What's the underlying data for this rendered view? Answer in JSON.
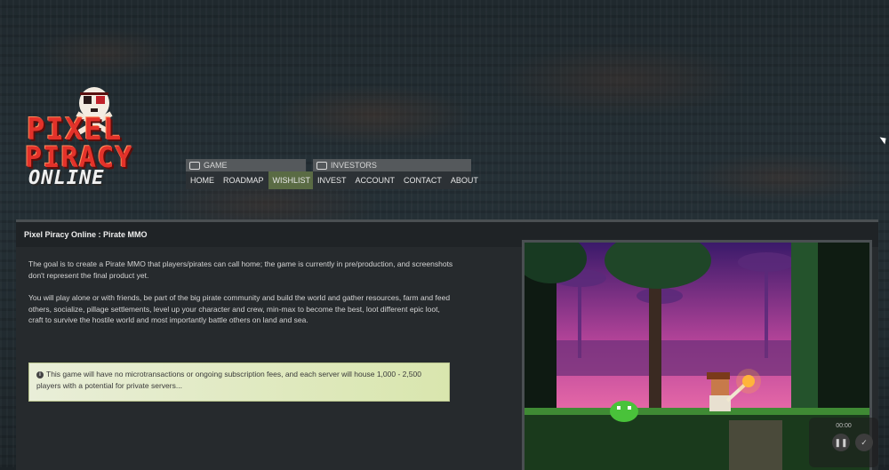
{
  "logo": {
    "line1": "PIXEL",
    "line2": "PIRACY",
    "line3": "ONLINE"
  },
  "nav": {
    "game": {
      "header": "GAME",
      "icon": "gamepad-icon",
      "items": [
        "HOME",
        "ROADMAP",
        "WISHLIST"
      ],
      "active": "WISHLIST"
    },
    "investors": {
      "header": "INVESTORS",
      "icon": "cash-icon",
      "items": [
        "INVEST",
        "ACCOUNT",
        "CONTACT",
        "ABOUT"
      ]
    }
  },
  "panel": {
    "title": "Pixel Piracy Online : Pirate MMO",
    "para1": "The goal is to create a Pirate MMO that players/pirates can call home; the game is currently in pre/production, and screenshots don't represent the final product yet.",
    "para2": "You will play alone or with friends, be part of the big pirate community and build the world and gather resources, farm and feed others, socialize, pillage settlements, level up your character and crew, min-max to become the best, loot different epic loot, craft to survive the hostile world and most importantly battle others on land and sea.",
    "notice": "This game will have no microtransactions or ongoing subscription fees, and each server will house 1,000 - 2,500 players with a potential for private servers...",
    "notice_icon": "info-icon"
  },
  "video": {
    "time": "00:00",
    "pause_icon": "pause-icon",
    "check_icon": "check-icon"
  },
  "colors": {
    "active_nav": "#5a6b44",
    "notice_bg": "#d9e6ae",
    "logo_red": "#e3322a"
  }
}
